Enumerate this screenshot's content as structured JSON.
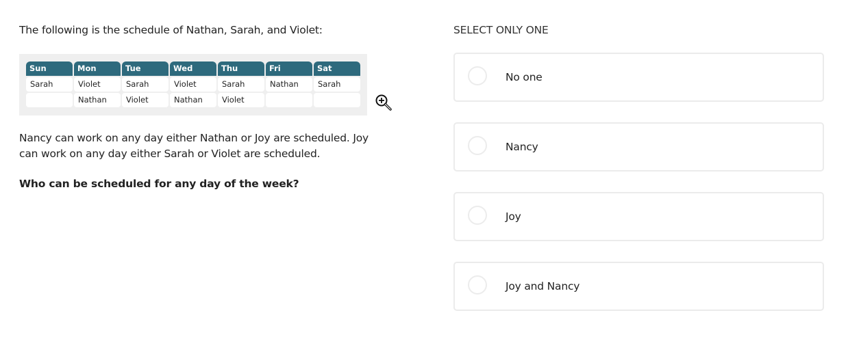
{
  "intro": "The following is the schedule of Nathan, Sarah, and Violet:",
  "schedule": {
    "days": [
      "Sun",
      "Mon",
      "Tue",
      "Wed",
      "Thu",
      "Fri",
      "Sat"
    ],
    "rows": [
      [
        "Sarah",
        "Violet",
        "Sarah",
        "Violet",
        "Sarah",
        "Nathan",
        "Sarah"
      ],
      [
        "",
        "Nathan",
        "Violet",
        "Nathan",
        "Violet",
        "",
        ""
      ]
    ],
    "header_color": "#2e6a7d"
  },
  "zoom_icon": "zoom-in-icon",
  "paragraph": "Nancy can work on any day either Nathan or Joy are scheduled. Joy can work on any day either Sarah or Violet are scheduled.",
  "question": "Who can be scheduled for any day of the week?",
  "answer": {
    "instruction": "SELECT ONLY ONE",
    "options": [
      {
        "label": "No one"
      },
      {
        "label": "Nancy"
      },
      {
        "label": "Joy"
      },
      {
        "label": "Joy and Nancy"
      }
    ]
  }
}
